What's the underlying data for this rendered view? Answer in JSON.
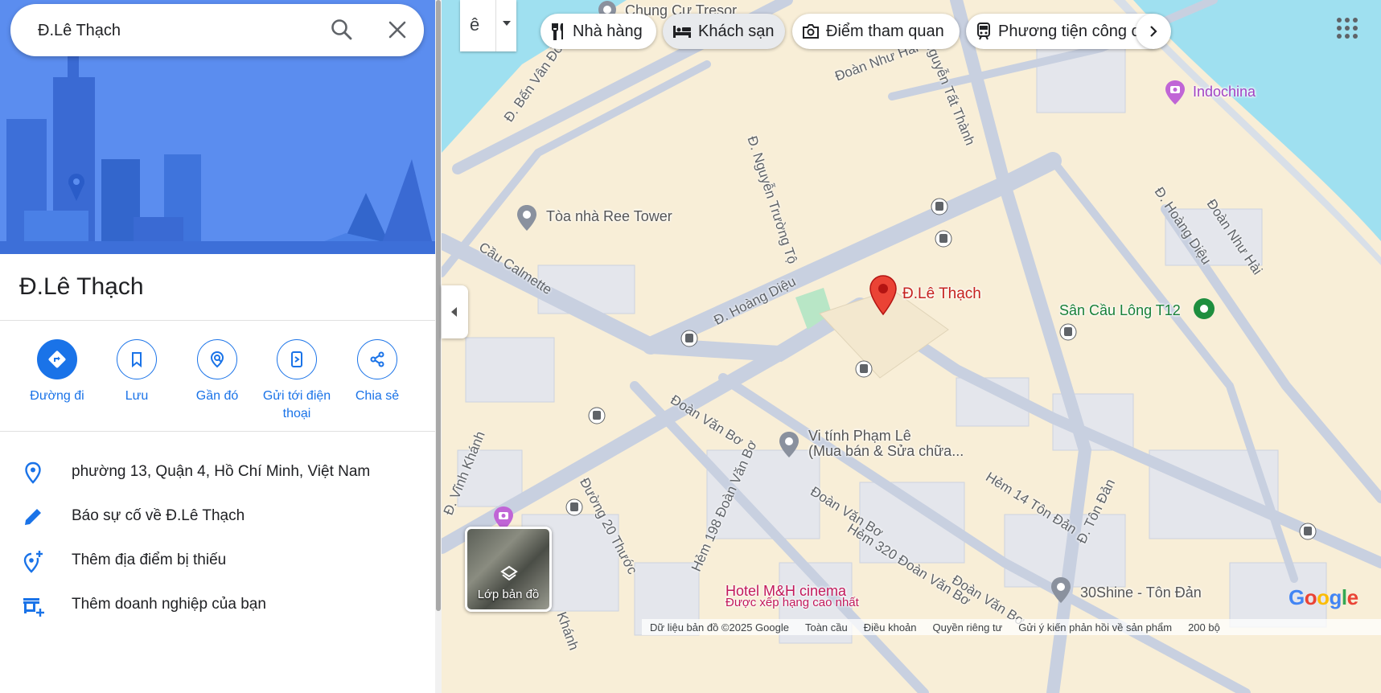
{
  "search": {
    "value": "Đ.Lê Thạch"
  },
  "place": {
    "title": "Đ.Lê Thạch"
  },
  "actions": [
    {
      "label": "Đường đi"
    },
    {
      "label": "Lưu"
    },
    {
      "label": "Gần đó"
    },
    {
      "label": "Gửi tới điện thoại"
    },
    {
      "label": "Chia sẻ"
    }
  ],
  "info": {
    "address": "phường 13, Quận 4, Hồ Chí Minh, Việt Nam",
    "report": "Báo sự cố về Đ.Lê Thạch",
    "add_missing": "Thêm địa điểm bị thiếu",
    "add_business": "Thêm doanh nghiệp của bạn"
  },
  "chips": [
    {
      "label": "Nhà hàng",
      "icon": "fork-knife-icon"
    },
    {
      "label": "Khách sạn",
      "icon": "bed-icon"
    },
    {
      "label": "Điểm tham quan",
      "icon": "camera-icon"
    },
    {
      "label": "Phương tiện công c",
      "icon": "train-icon"
    }
  ],
  "map": {
    "layers_label": "Lớp bản đồ",
    "pin_label": "Đ.Lê Thạch",
    "pois": [
      {
        "name": "Chung Cư Tresor"
      },
      {
        "name": "Tòa nhà Ree Tower"
      },
      {
        "name": "Indochina"
      },
      {
        "name": "Sân Cầu Lông T12"
      },
      {
        "name": "Vi tính Phạm Lê"
      },
      {
        "name": "(Mua bán & Sửa chữa..."
      },
      {
        "name": "30Shine - Tôn Đản"
      },
      {
        "name": "Hotel M&H cinema"
      },
      {
        "name": "Được xếp hạng cao nhất"
      }
    ],
    "streets": [
      "Đ. Bến Vân Đồn",
      "Đoàn Như Hài",
      "Nguyễn Tất Thành",
      "Đ. Nguyễn Trường Tộ",
      "Cầu Calmette",
      "Đ. Hoàng Diệu",
      "Đoàn Văn Bơ",
      "Đường 20 Thước",
      "Hẻm 198 Đoàn Văn Bơ",
      "Hẻm 320 Đoàn Văn Bơ",
      "Đoàn Văn Bơ",
      "Đoàn Văn Bơ",
      "Hẻm 14 Tôn Đản",
      "Đ. Tôn Đản",
      "Đ. Hoàng Diệu",
      "Đoàn Như Hài",
      "Đ. Vĩnh Khánh",
      "Khánh"
    ],
    "logo": "Google"
  },
  "attribution": {
    "data": "Dữ liệu bản đồ ©2025 Google",
    "global": "Toàn cầu",
    "terms": "Điều khoản",
    "privacy": "Quyền riêng tư",
    "feedback": "Gửi ý kiến phản hồi về sản phẩm",
    "scale": "200 bộ"
  },
  "colors": {
    "accent": "#1a73e8",
    "pin": "#ea4335",
    "water": "#9fe0f0",
    "land": "#f8eed7",
    "road": "#c8d0e0"
  }
}
